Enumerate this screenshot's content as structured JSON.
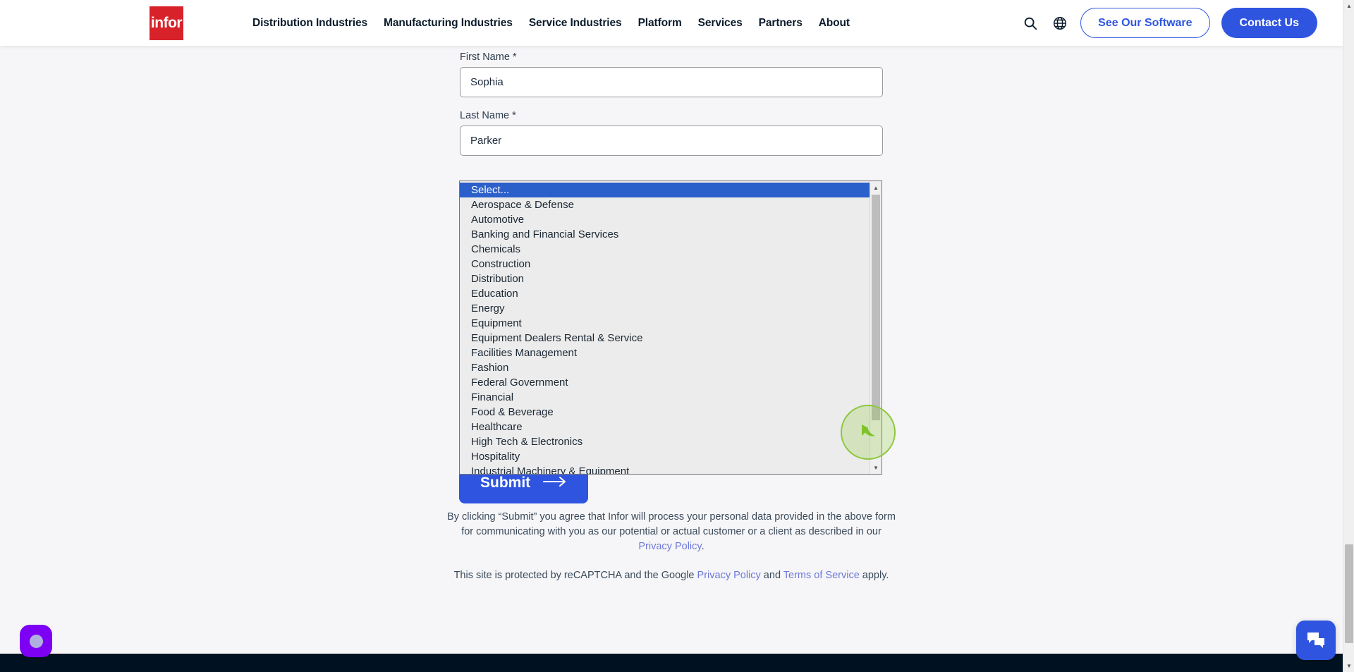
{
  "header": {
    "logo_text": "infor",
    "nav_items": [
      {
        "label": "Distribution Industries"
      },
      {
        "label": "Manufacturing Industries"
      },
      {
        "label": "Service Industries"
      },
      {
        "label": "Platform"
      },
      {
        "label": "Services"
      },
      {
        "label": "Partners"
      },
      {
        "label": "About"
      }
    ],
    "search_icon": "search-icon",
    "globe_icon": "globe-icon",
    "see_software_label": "See Our Software",
    "contact_label": "Contact Us",
    "accent_blue": "#2f55e0",
    "logo_red": "#d8222a"
  },
  "form": {
    "first_name": {
      "label": "First Name *",
      "value": "Sophia",
      "placeholder": "First Name"
    },
    "last_name": {
      "label": "Last Name *",
      "value": "Parker",
      "placeholder": "Last Name"
    },
    "submit_label": "Submit",
    "submit_arrow": "arrow-right-icon"
  },
  "industry_select": {
    "selected_value": "Select...",
    "options": [
      "Select...",
      "Aerospace & Defense",
      "Automotive",
      "Banking and Financial Services",
      "Chemicals",
      "Construction",
      "Distribution",
      "Education",
      "Energy",
      "Equipment",
      "Equipment Dealers Rental & Service",
      "Facilities Management",
      "Fashion",
      "Federal Government",
      "Financial",
      "Food & Beverage",
      "Healthcare",
      "High Tech & Electronics",
      "Hospitality",
      "Industrial Machinery & Equipment"
    ],
    "highlight_color": "#2b5fc9",
    "scroll_up_icon": "triangle-up-icon",
    "scroll_down_icon": "triangle-down-icon"
  },
  "legal": {
    "consent_line1": "By clicking “Submit” you agree that Infor will process your personal data provided in the above form",
    "consent_line2": "for communicating with you as our potential or actual customer or a client as described in our",
    "consent_link": "Privacy Policy",
    "consent_period": ".",
    "recaptcha_prefix": "This site is protected by reCAPTCHA and the Google ",
    "recaptcha_link1": "Privacy Policy",
    "recaptcha_mid": " and ",
    "recaptcha_link2": "Terms of Service",
    "recaptcha_suffix": " apply.",
    "link_color": "#6d78d8"
  },
  "widgets": {
    "privacy_badge": "privacy-badge-icon",
    "chat_icon": "chat-bubbles-icon",
    "cursor": "mouse-pointer-icon"
  }
}
